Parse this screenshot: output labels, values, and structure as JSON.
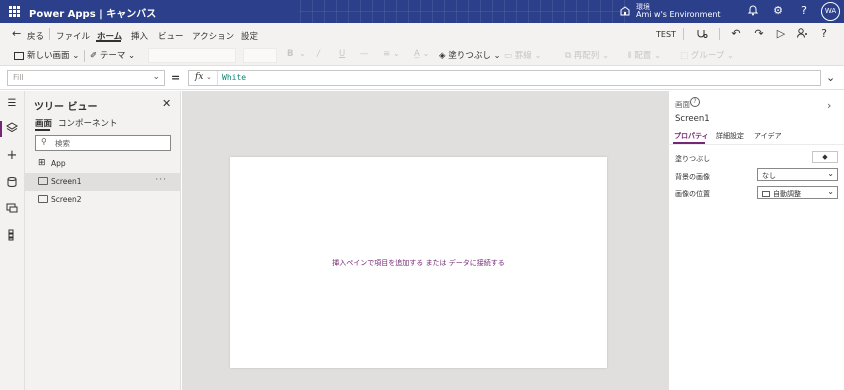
{
  "titlebar": {
    "app_name": "Power Apps",
    "separator": "|",
    "app_mode": "キャンバス",
    "env_label": "環境",
    "env_name": "Ami w's Environment",
    "avatar_initials": "WA",
    "bar_color": "#2c3f8a"
  },
  "menu": {
    "back": "戻る",
    "items": [
      "ファイル",
      "ホーム",
      "挿入",
      "ビュー",
      "アクション",
      "設定"
    ],
    "active": "ホーム",
    "test_label": "TEST"
  },
  "toolbar": {
    "new_screen": "新しい画面",
    "theme": "テーマ",
    "bold": "B",
    "italic": "/",
    "underline": "U",
    "strike": "—",
    "fill": "塗りつぶし",
    "border": "罫線",
    "reorder": "再配列",
    "align": "配置",
    "group": "グループ"
  },
  "formula": {
    "property": "Fill",
    "equals": "=",
    "fx": "fx",
    "value": "White"
  },
  "tree": {
    "title": "ツリー ビュー",
    "tabs": [
      "画面",
      "コンポーネント"
    ],
    "search_placeholder": "検索",
    "items": [
      {
        "label": "App",
        "icon": "app-icon"
      },
      {
        "label": "Screen1",
        "icon": "screen-icon",
        "selected": true
      },
      {
        "label": "Screen2",
        "icon": "screen-icon"
      }
    ],
    "more": "···"
  },
  "canvas": {
    "hint": "挿入ペインで項目を追加する または データに接続する",
    "hint_color": "#742774"
  },
  "properties": {
    "type_label": "画面",
    "name": "Screen1",
    "tabs": [
      "プロパティ",
      "詳細設定",
      "アイデア"
    ],
    "fill_label": "塗りつぶし",
    "bg_image_label": "背景の画像",
    "bg_image_value": "なし",
    "image_pos_label": "画像の位置",
    "image_pos_value": "自動調整",
    "accent_color": "#742774"
  }
}
